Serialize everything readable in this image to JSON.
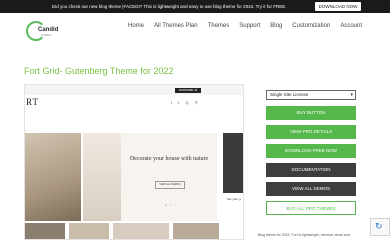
{
  "topbar": {
    "message": "Did you check our new blog theme |FACEDI? This is lightweight and easy to use blog theme for 2024. Try it for FREE.",
    "download": "DOWNLOAD NOW"
  },
  "logo": {
    "name": "Candid",
    "sub": "THEMES"
  },
  "nav": [
    "Home",
    "All Themes Plan",
    "Themes",
    "Support",
    "Blog",
    "Customization",
    "Account"
  ],
  "page_title": "Fort Grid- Gutenberg Theme for 2022",
  "preview": {
    "logo_text": "RT",
    "subscribe": "SUBSCRIBE US",
    "hero_heading": "Decorate your house with nature",
    "hero_button": "VIEW ALL DEMOS",
    "side_text": "Set your g"
  },
  "sidebar": {
    "license_selected": "Single Site License",
    "buttons": [
      "BUY BUTTON",
      "VIEW PRO DETAILS",
      "DOWNLOAD FREE NOW",
      "DOCUMENTATION",
      "VIEW ALL DEMOS",
      "BUY ALL PRO THEMES"
    ]
  },
  "description": "Blog theme for 2022, Fort is lightweight, minimal, clean and",
  "colors": {
    "accent": "#56b74c",
    "title": "#7ac143",
    "dark": "#3e3e3e"
  }
}
